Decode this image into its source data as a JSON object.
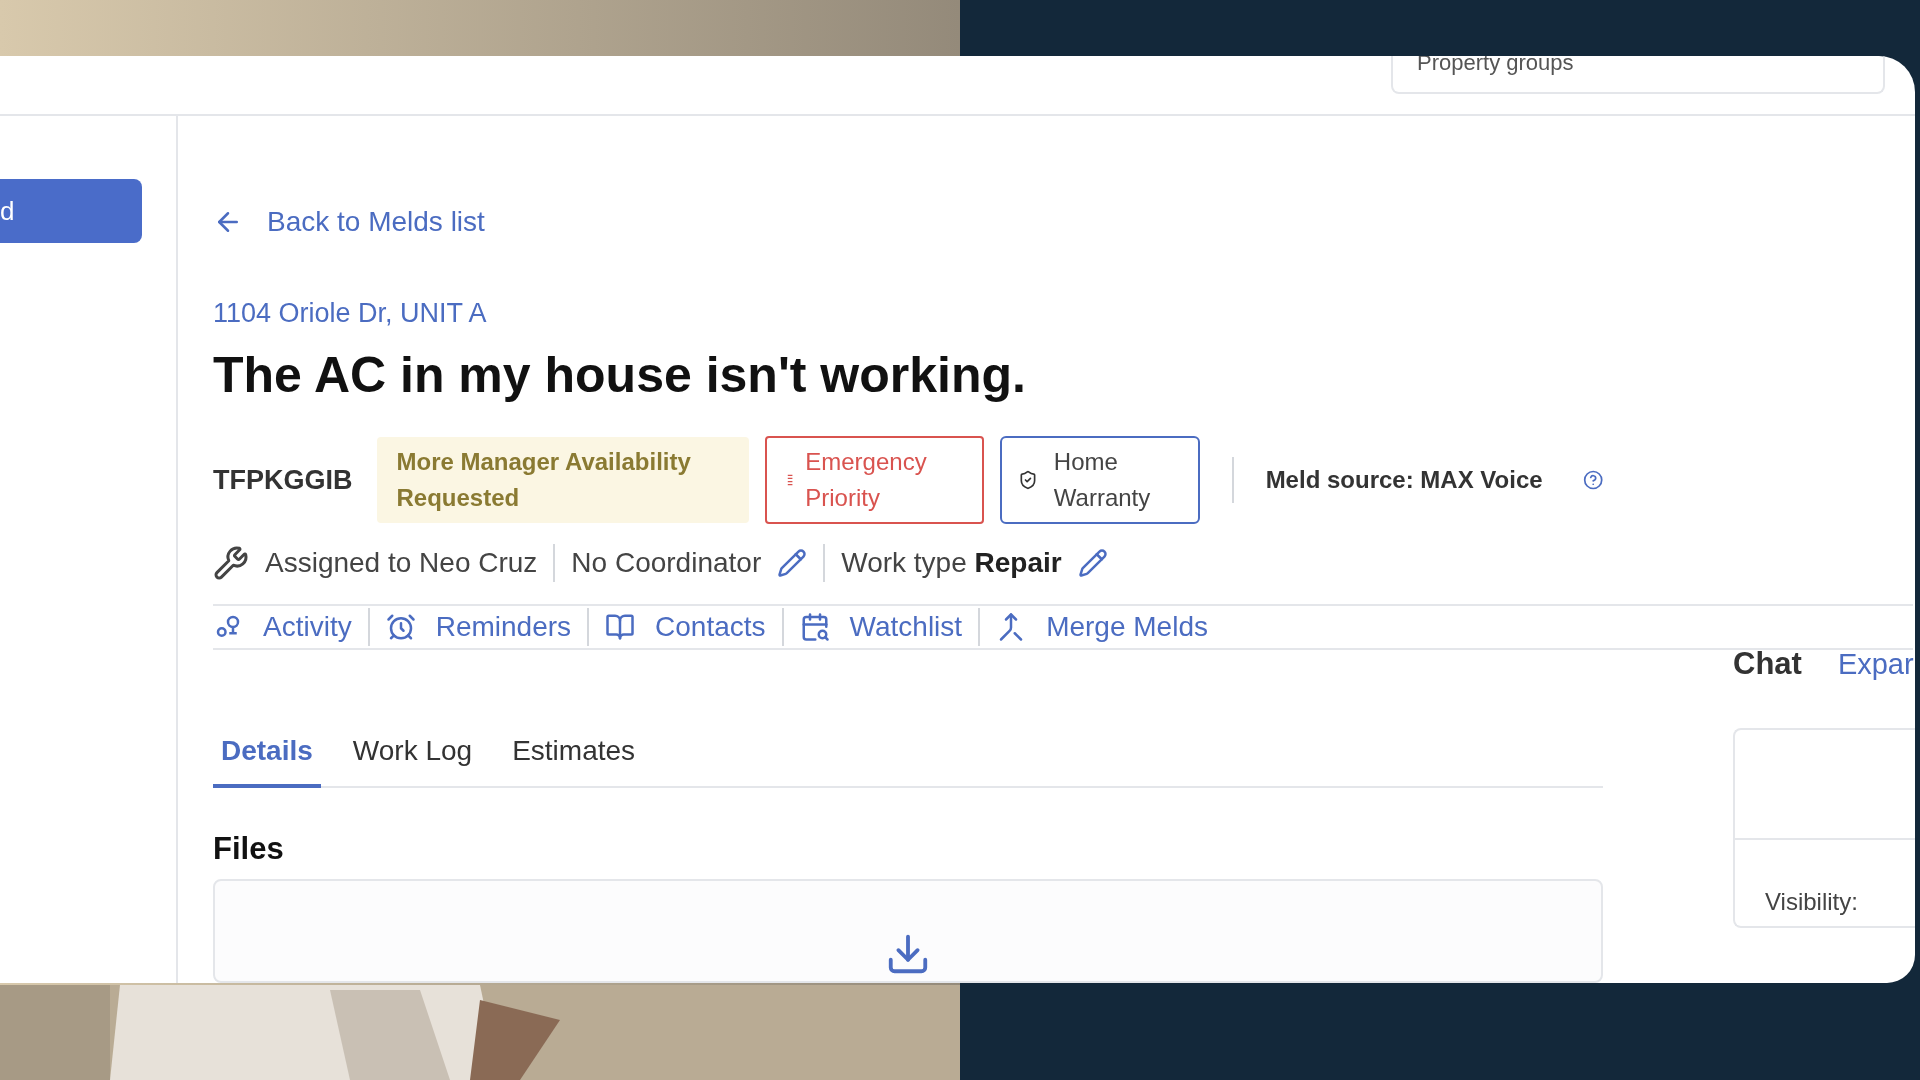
{
  "header": {
    "property_groups_field": "Property groups"
  },
  "sidebar": {
    "button": "d"
  },
  "back_link": "Back to Melds list",
  "address": "1104 Oriole Dr, UNIT A",
  "title": "The AC in my house isn't working.",
  "tags": [
    {
      "kind": "id",
      "label": "TFPKGGIB"
    },
    {
      "kind": "status",
      "label": "More Manager Availability Requested"
    },
    {
      "kind": "priority",
      "label": "Emergency Priority"
    },
    {
      "kind": "warranty",
      "label": "Home Warranty"
    }
  ],
  "meld_source": {
    "label": "Meld source:",
    "value": "MAX Voice"
  },
  "assignment": {
    "assigned": "Assigned to Neo Cruz",
    "coordinator": "No Coordinator",
    "work_type_label": "Work type",
    "work_type": "Repair"
  },
  "actions": [
    {
      "kind": "activity",
      "label": "Activity"
    },
    {
      "kind": "reminders",
      "label": "Reminders"
    },
    {
      "kind": "contacts",
      "label": "Contacts"
    },
    {
      "kind": "watchlist",
      "label": "Watchlist"
    },
    {
      "kind": "merge",
      "label": "Merge Melds"
    }
  ],
  "tabs": [
    {
      "label": "Details",
      "selected": true
    },
    {
      "label": "Work Log",
      "selected": false
    },
    {
      "label": "Estimates",
      "selected": false
    }
  ],
  "files": {
    "title": "Files"
  },
  "chat": {
    "title": "Chat",
    "expand": "Expar",
    "visibility": "Visibility:"
  }
}
